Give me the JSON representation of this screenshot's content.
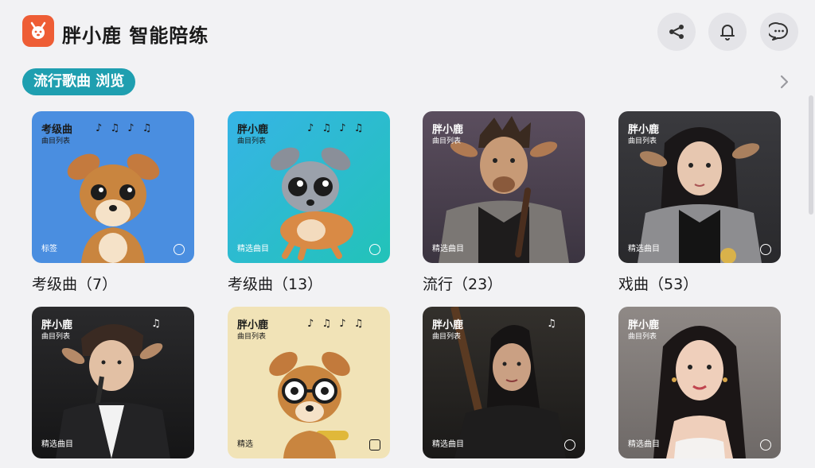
{
  "header": {
    "app_title": "胖小鹿 智能陪练",
    "icons": [
      "share-icon",
      "bell-icon",
      "message-icon"
    ]
  },
  "section": {
    "pill_label": "流行歌曲 浏览"
  },
  "colors": {
    "accent": "#1f9fb0",
    "logo": "#ee5d35",
    "background": "#f2f2f4"
  },
  "cards": [
    {
      "title": "考级曲",
      "subtitle": "曲目列表",
      "notes": "♪ ♫ ♪ ♫",
      "corner": "标签",
      "caption": "考级曲（7）"
    },
    {
      "title": "胖小鹿",
      "subtitle": "曲目列表",
      "notes": "♪ ♫ ♪ ♫",
      "corner": "精选曲目",
      "caption": "考级曲（13）"
    },
    {
      "title": "胖小鹿",
      "subtitle": "曲目列表",
      "notes": "",
      "corner": "精选曲目",
      "caption": "流行（23）"
    },
    {
      "title": "胖小鹿",
      "subtitle": "曲目列表",
      "notes": "",
      "corner": "精选曲目",
      "caption": "戏曲（53）"
    },
    {
      "title": "胖小鹿",
      "subtitle": "曲目列表",
      "notes": "♫",
      "corner": "精选曲目",
      "caption": ""
    },
    {
      "title": "胖小鹿",
      "subtitle": "曲目列表",
      "notes": "♪ ♫ ♪ ♫",
      "corner": "精选",
      "caption": ""
    },
    {
      "title": "胖小鹿",
      "subtitle": "曲目列表",
      "notes": "♫",
      "corner": "精选曲目",
      "caption": ""
    },
    {
      "title": "胖小鹿",
      "subtitle": "曲目列表",
      "notes": "",
      "corner": "精选曲目",
      "caption": ""
    }
  ]
}
